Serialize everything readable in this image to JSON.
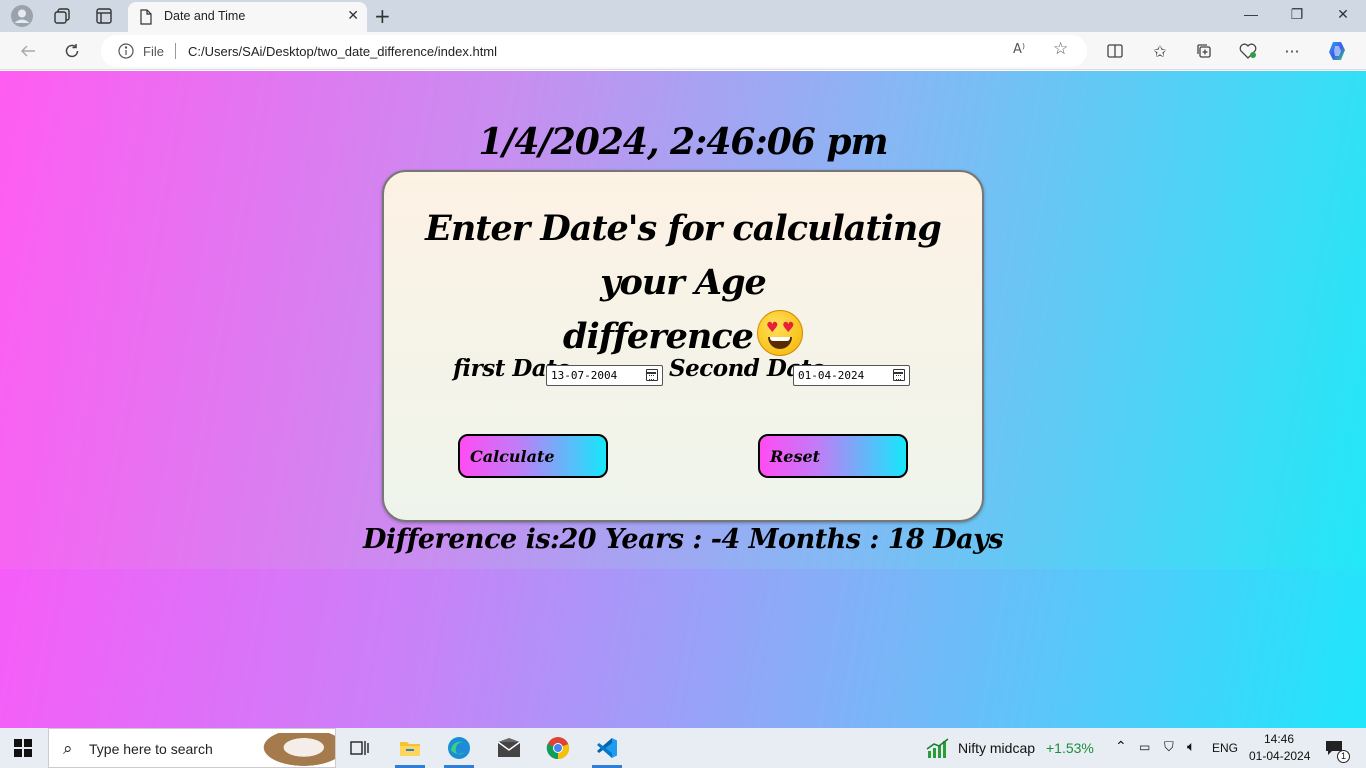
{
  "browser": {
    "tab_title": "Date and Time",
    "new_tab": "+",
    "omnibox": {
      "scheme_label": "File",
      "url": "C:/Users/SAi/Desktop/two_date_difference/index.html"
    },
    "window_controls": {
      "minimize": "—",
      "restore": "❐",
      "close": "✕"
    }
  },
  "page": {
    "clock": "1/4/2024, 2:46:06 pm",
    "heading_line1": "Enter Date's for calculating your Age",
    "heading_line2": "difference",
    "emoji": "smiling-face-with-heart-eyes",
    "first_date_label": "first Date",
    "first_date_value": "13-07-2004",
    "second_date_label": "Second Date",
    "second_date_value": "01-04-2024",
    "calculate_label": "Calculate",
    "reset_label": "Reset",
    "result": "Difference is:20 Years : -4 Months : 18 Days"
  },
  "taskbar": {
    "search_placeholder": "Type here to search",
    "widget_name": "Nifty midcap",
    "widget_change": "+1.53%",
    "language": "ENG",
    "time": "14:46",
    "date": "01-04-2024",
    "notification_count": "1"
  },
  "colors": {
    "gradient_pink": "#ff55f8",
    "gradient_cyan": "#1fe6fb",
    "widget_green": "#1a8f3a"
  }
}
